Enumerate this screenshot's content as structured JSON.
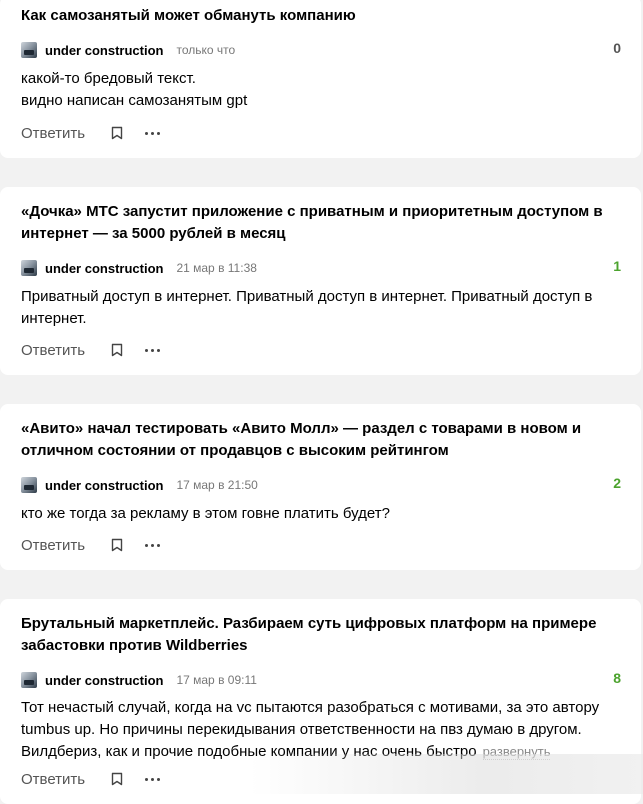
{
  "comments": [
    {
      "title": "Как самозанятый может обмануть компанию",
      "author": "under construction",
      "time": "только что",
      "rating": "0",
      "text_lines": [
        "какой-то бредовый текст.",
        "видно написан самозанятым gpt"
      ],
      "reply_label": "Ответить"
    },
    {
      "title": "«Дочка» МТС запустит приложение с приватным и приоритетным доступом в интернет — за 5000 рублей в месяц",
      "author": "under construction",
      "time": "21 мар в 11:38",
      "rating": "1",
      "text": "Приватный доступ в интернет. Приватный доступ в интернет. Приватный доступ в интернет.",
      "reply_label": "Ответить"
    },
    {
      "title": "«Авито» начал тестировать «Авито Молл» — раздел с товарами в новом и отличном состоянии от продавцов с высоким рейтингом",
      "author": "under construction",
      "time": "17 мар в 21:50",
      "rating": "2",
      "text": "кто же тогда за рекламу в этом говне платить будет?",
      "reply_label": "Ответить"
    },
    {
      "title": "Брутальный маркетплейс. Разбираем суть цифровых платформ на примере забастовки против Wildberries",
      "author": "under construction",
      "time": "17 мар в 09:11",
      "rating": "8",
      "text": "Тот нечастый случай, когда на vc пытаются разобраться с мотивами, за это автору tumbus up. Но причины перекидывания ответственности на пвз думаю в другом. Вилдбериз, как и прочие подобные компании у нас очень быстро",
      "expand_label": "развернуть",
      "reply_label": "Ответить"
    }
  ],
  "colors": {
    "positive_rating": "#4ca32e",
    "background": "#f2f2f2"
  },
  "icons": {
    "bookmark": "bookmark-icon",
    "more": "more-dots-icon",
    "avatar": "avatar"
  }
}
